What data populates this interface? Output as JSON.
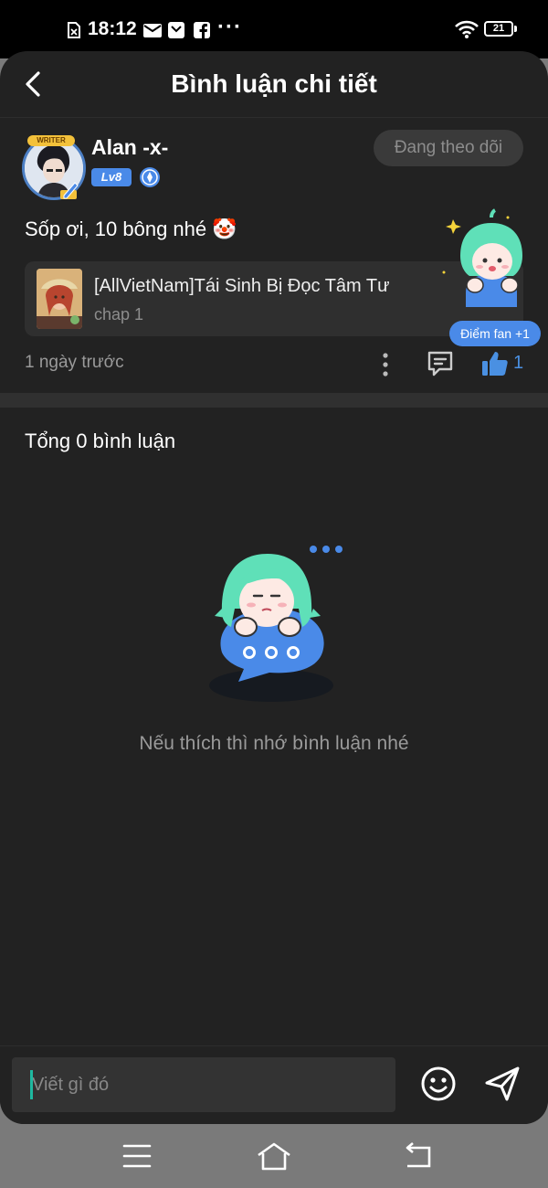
{
  "status_bar": {
    "time": "18:12",
    "more": "···",
    "battery": "21"
  },
  "header": {
    "title": "Bình luận chi tiết"
  },
  "comment": {
    "avatar_badge": "WRITER",
    "username": "Alan -x-",
    "level": "Lv8",
    "follow_label": "Đang theo dõi",
    "text": "Sốp ơi, 10 bông nhé 🤡",
    "book_title": "[AllVietNam]Tái Sinh Bị Đọc Tâm Tư",
    "chapter": "chap 1",
    "time_ago": "1 ngày trước",
    "like_count": "1",
    "fan_badge": "Điểm fan +1"
  },
  "replies": {
    "total_label": "Tổng 0 bình luận",
    "empty_text": "Nếu thích thì nhớ bình luận nhé"
  },
  "input": {
    "placeholder": "Viết gì đó"
  },
  "colors": {
    "accent": "#4a8ae8",
    "like": "#4a90e2",
    "mascot_hair": "#5fe0b8",
    "background": "#222222"
  }
}
